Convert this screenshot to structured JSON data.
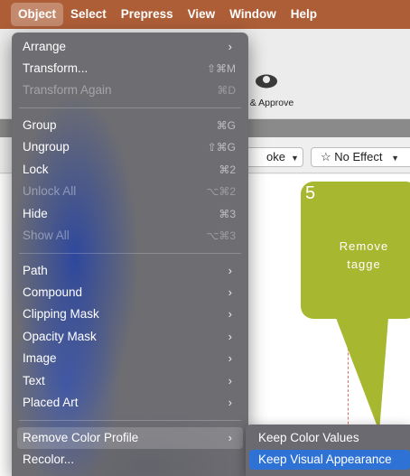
{
  "menubar": {
    "items": [
      "Object",
      "Select",
      "Prepress",
      "View",
      "Window",
      "Help"
    ],
    "active_index": 0,
    "background_color": "#ad5e37"
  },
  "toolbar": {
    "share_approve_label": "e & Approve"
  },
  "properties_bar": {
    "stroke_dropdown": "oke",
    "effect_dropdown": "No Effect"
  },
  "callout": {
    "number": "5",
    "text": "Remove\ntagge",
    "color": "#a8b730"
  },
  "object_menu": {
    "items": [
      {
        "label": "Arrange",
        "submenu": true,
        "enabled": true
      },
      {
        "label": "Transform...",
        "shortcut": "⇧⌘M",
        "enabled": true
      },
      {
        "label": "Transform Again",
        "shortcut": "⌘D",
        "enabled": false
      },
      {
        "label": "Group",
        "shortcut": "⌘G",
        "enabled": true
      },
      {
        "label": "Ungroup",
        "shortcut": "⇧⌘G",
        "enabled": true
      },
      {
        "label": "Lock",
        "shortcut": "⌘2",
        "enabled": true
      },
      {
        "label": "Unlock All",
        "shortcut": "⌥⌘2",
        "enabled": false
      },
      {
        "label": "Hide",
        "shortcut": "⌘3",
        "enabled": true
      },
      {
        "label": "Show All",
        "shortcut": "⌥⌘3",
        "enabled": false
      },
      {
        "label": "Path",
        "submenu": true,
        "enabled": true
      },
      {
        "label": "Compound",
        "submenu": true,
        "enabled": true
      },
      {
        "label": "Clipping Mask",
        "submenu": true,
        "enabled": true
      },
      {
        "label": "Opacity Mask",
        "submenu": true,
        "enabled": true
      },
      {
        "label": "Image",
        "submenu": true,
        "enabled": true
      },
      {
        "label": "Text",
        "submenu": true,
        "enabled": true
      },
      {
        "label": "Placed Art",
        "submenu": true,
        "enabled": true
      },
      {
        "label": "Remove Color Profile",
        "submenu": true,
        "enabled": true,
        "highlighted": true
      },
      {
        "label": "Recolor...",
        "enabled": true
      }
    ]
  },
  "submenu": {
    "items": [
      {
        "label": "Keep Color Values",
        "selected": false
      },
      {
        "label": "Keep Visual Appearance",
        "selected": true
      }
    ],
    "selected_color": "#2f72d6"
  }
}
